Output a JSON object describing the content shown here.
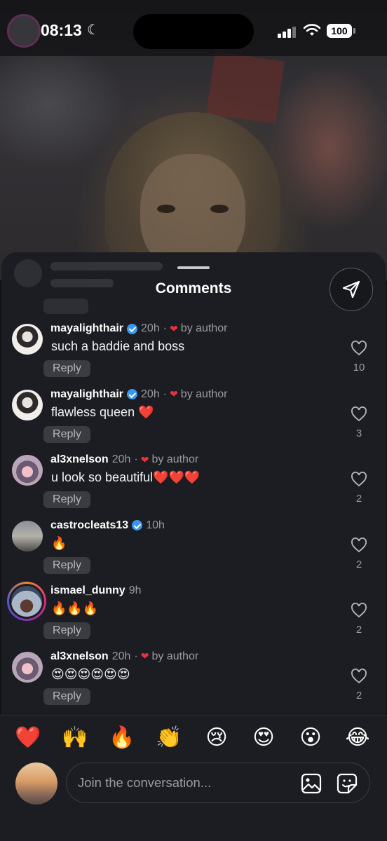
{
  "status_bar": {
    "time": "08:13",
    "battery": "100"
  },
  "sheet": {
    "title": "Comments"
  },
  "comments": [
    {
      "username": "mayalighthair",
      "verified": true,
      "time": "20h",
      "liked_by_author": true,
      "by_author_label": "by author",
      "text": "such a baddie and boss",
      "reply_label": "Reply",
      "likes": "10"
    },
    {
      "username": "mayalighthair",
      "verified": true,
      "time": "20h",
      "liked_by_author": true,
      "by_author_label": "by author",
      "text": "flawless queen ❤️",
      "reply_label": "Reply",
      "likes": "3"
    },
    {
      "username": "al3xnelson",
      "verified": false,
      "time": "20h",
      "liked_by_author": true,
      "by_author_label": "by author",
      "text": "u look so beautiful❤️❤️❤️",
      "reply_label": "Reply",
      "likes": "2"
    },
    {
      "username": "castrocleats13",
      "verified": true,
      "time": "10h",
      "liked_by_author": false,
      "by_author_label": "",
      "text": "🔥",
      "reply_label": "Reply",
      "likes": "2"
    },
    {
      "username": "ismael_dunny",
      "verified": false,
      "time": "9h",
      "liked_by_author": false,
      "by_author_label": "",
      "text": "🔥🔥🔥",
      "reply_label": "Reply",
      "likes": "2"
    },
    {
      "username": "al3xnelson",
      "verified": false,
      "time": "20h",
      "liked_by_author": true,
      "by_author_label": "by author",
      "text": "😍😍😍😍😍😍",
      "reply_label": "Reply",
      "likes": "2"
    }
  ],
  "emoji_bar": [
    "❤️",
    "🙌",
    "🔥",
    "👏",
    "😢",
    "😍",
    "😮",
    "😂"
  ],
  "composer": {
    "placeholder": "Join the conversation..."
  },
  "icons": {
    "share": "send-icon",
    "like": "heart-outline-icon",
    "gallery": "image-icon",
    "sticker": "sticker-icon"
  },
  "colors": {
    "sheet_bg": "#1b1d22",
    "verified": "#3897f0",
    "author_heart": "#e8323b",
    "reply_bg": "#3a3c42"
  }
}
